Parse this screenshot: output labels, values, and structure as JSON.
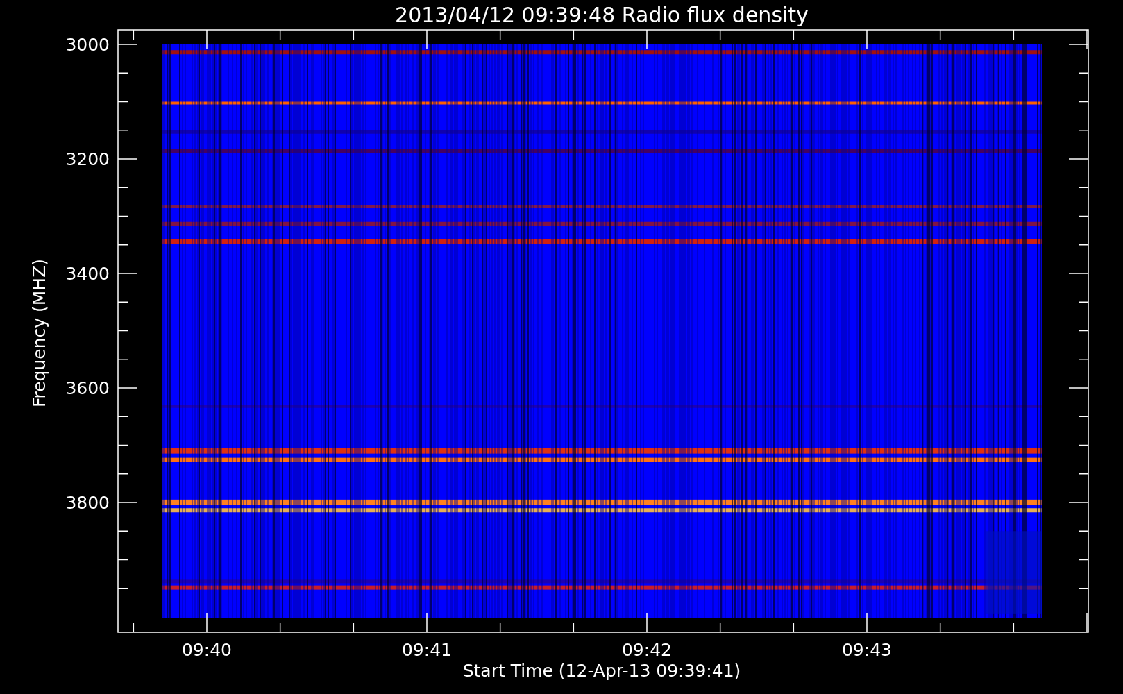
{
  "title": "2013/04/12 09:39:48 Radio flux density",
  "y_axis": {
    "label": "Frequency (MHZ)",
    "ticks": [
      "3000",
      "3200",
      "3400",
      "3600",
      "3800"
    ]
  },
  "x_axis": {
    "label": "Start Time (12-Apr-13 09:39:41)",
    "ticks": [
      "09:40",
      "09:41",
      "09:42",
      "09:43"
    ]
  }
}
